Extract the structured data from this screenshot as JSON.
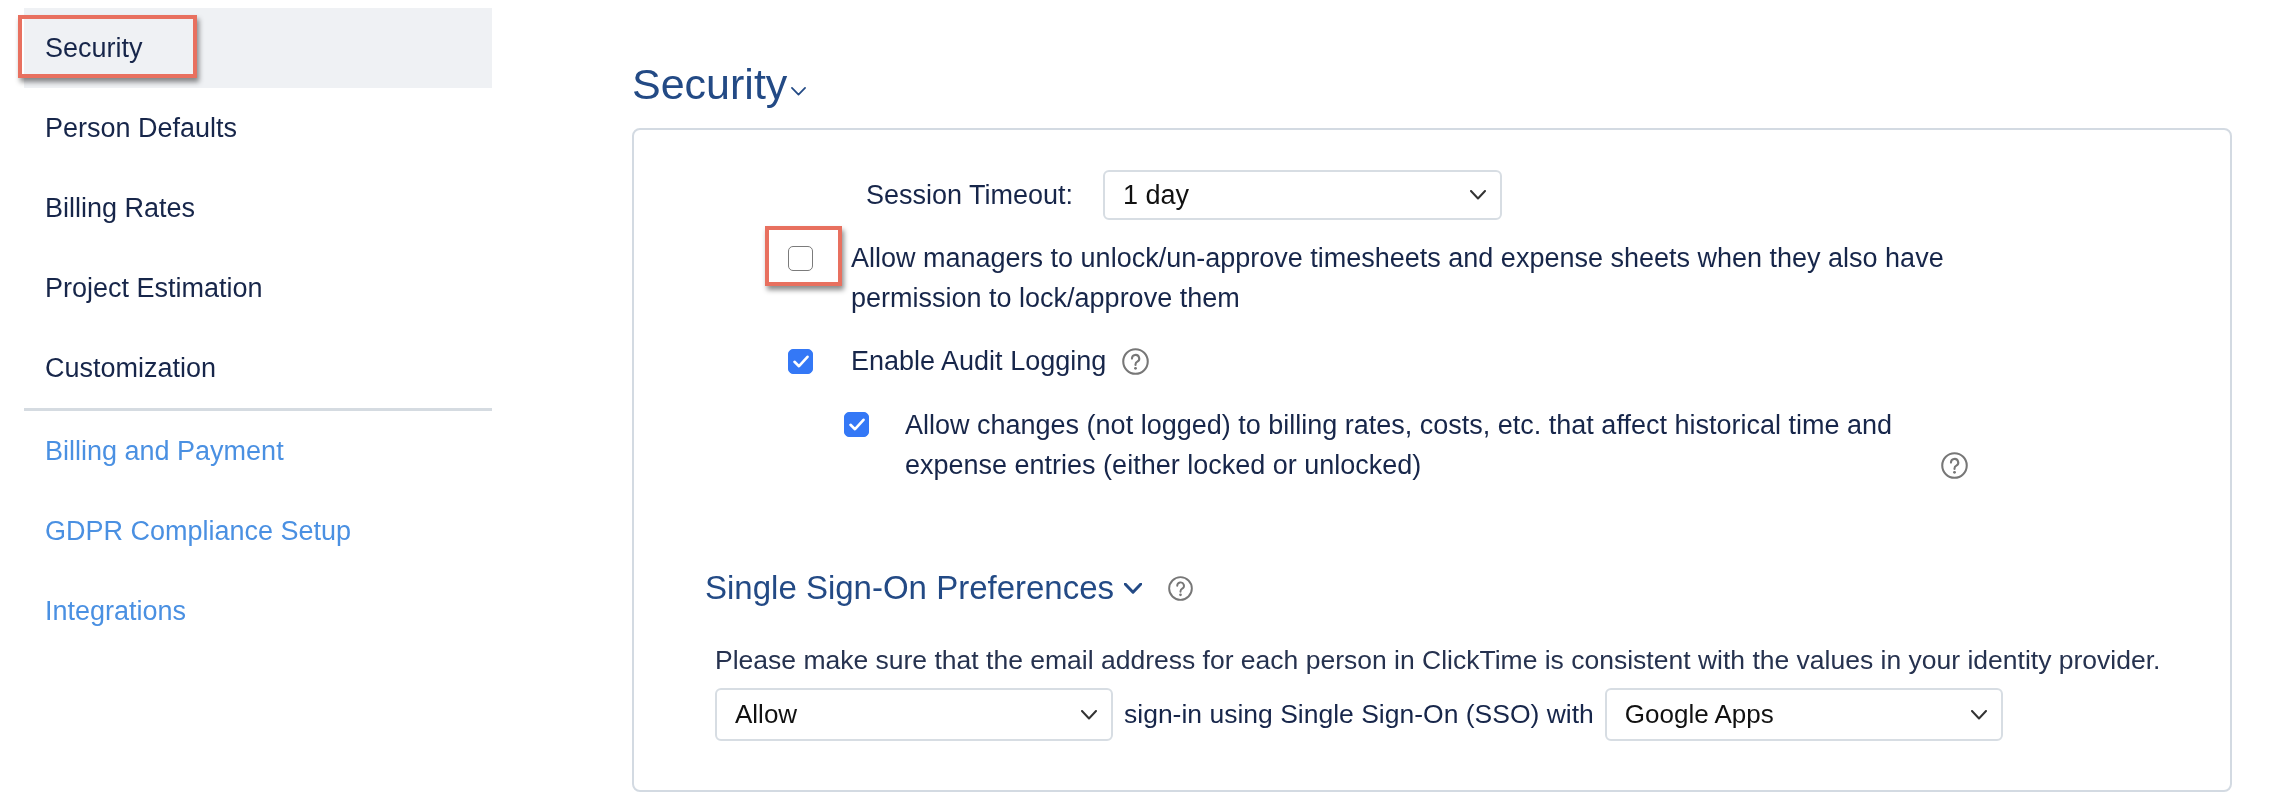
{
  "sidebar": {
    "sections": [
      {
        "kind": "settings",
        "items": [
          {
            "label": "Security",
            "selected": true,
            "highlighted": true
          },
          {
            "label": "Person Defaults",
            "selected": false,
            "highlighted": false
          },
          {
            "label": "Billing Rates",
            "selected": false,
            "highlighted": false
          },
          {
            "label": "Project Estimation",
            "selected": false,
            "highlighted": false
          },
          {
            "label": "Customization",
            "selected": false,
            "highlighted": false
          }
        ]
      },
      {
        "kind": "links",
        "items": [
          {
            "label": "Billing and Payment",
            "selected": false,
            "highlighted": false
          },
          {
            "label": "GDPR Compliance Setup",
            "selected": false,
            "highlighted": false
          },
          {
            "label": "Integrations",
            "selected": false,
            "highlighted": false
          }
        ]
      }
    ]
  },
  "security": {
    "title": "Security",
    "expanded": true,
    "session_timeout": {
      "label": "Session Timeout:",
      "value": "1 day"
    },
    "options": [
      {
        "label": "Allow managers to unlock/un-approve timesheets and expense sheets when they also have permission to lock/approve them",
        "checked": false,
        "highlighted": true,
        "help": false
      },
      {
        "label": "Enable Audit Logging",
        "checked": true,
        "highlighted": false,
        "help": true,
        "children": [
          {
            "label": "Allow changes (not logged) to billing rates, costs, etc. that affect historical time and expense entries (either locked or unlocked)",
            "checked": true,
            "highlighted": false,
            "help": true
          }
        ]
      }
    ]
  },
  "sso": {
    "title": "Single Sign-On Preferences",
    "expanded": true,
    "help": true,
    "note": "Please make sure that the email address for each person in ClickTime is consistent with the values in your identity provider.",
    "sign_in": {
      "mode": "Allow",
      "connector": "sign-in using Single Sign-On (SSO) with",
      "provider": "Google Apps"
    }
  }
}
